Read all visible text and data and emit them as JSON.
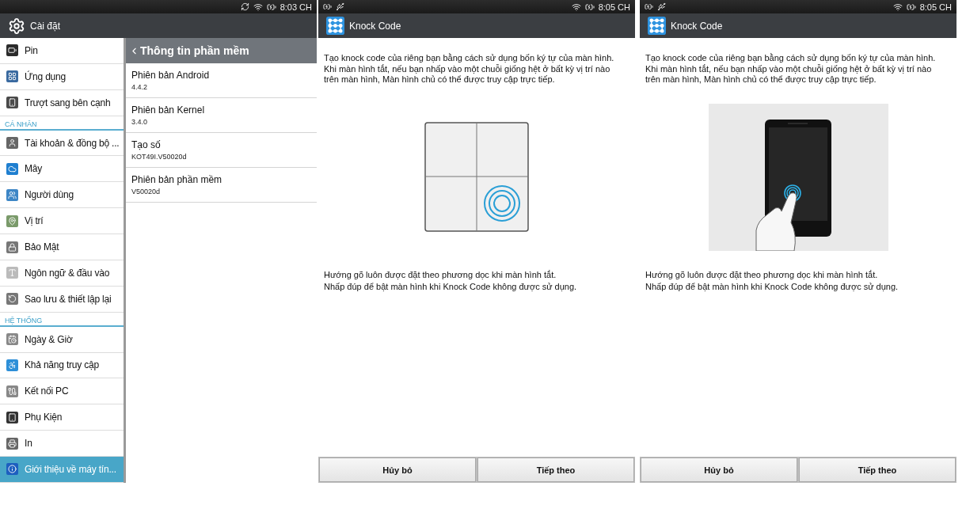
{
  "screens": [
    {
      "kind": "settings",
      "status_bar": {
        "time": "8:03 CH"
      },
      "title": "Cài đặt",
      "sidebar": [
        {
          "kind": "item",
          "label": "Pin",
          "selected": false
        },
        {
          "kind": "item",
          "label": "Ứng dụng",
          "selected": false
        },
        {
          "kind": "item",
          "label": "Trượt sang bên cạnh",
          "selected": false
        },
        {
          "kind": "header",
          "label": "CÁ NHÂN"
        },
        {
          "kind": "item",
          "label": "Tài khoản & đồng bộ ...",
          "selected": false
        },
        {
          "kind": "item",
          "label": "Mây",
          "selected": false
        },
        {
          "kind": "item",
          "label": "Người dùng",
          "selected": false
        },
        {
          "kind": "item",
          "label": "Vị trí",
          "selected": false
        },
        {
          "kind": "item",
          "label": "Bảo Mật",
          "selected": false
        },
        {
          "kind": "item",
          "label": "Ngôn ngữ & đầu vào",
          "selected": false
        },
        {
          "kind": "item",
          "label": "Sao lưu & thiết lập lại",
          "selected": false
        },
        {
          "kind": "header",
          "label": "HỆ THỐNG"
        },
        {
          "kind": "item",
          "label": "Ngày & Giờ",
          "selected": false
        },
        {
          "kind": "item",
          "label": "Khả năng truy cập",
          "selected": false
        },
        {
          "kind": "item",
          "label": "Kết nối PC",
          "selected": false
        },
        {
          "kind": "item",
          "label": "Phụ Kiện",
          "selected": false
        },
        {
          "kind": "item",
          "label": "In",
          "selected": false
        },
        {
          "kind": "item",
          "label": "Giới thiệu về máy tín...",
          "selected": true
        }
      ],
      "detail": {
        "title": "Thông tin phần mềm",
        "items": [
          {
            "label": "Phiên bản Android",
            "value": "4.4.2"
          },
          {
            "label": "Phiên bản Kernel",
            "value": "3.4.0"
          },
          {
            "label": "Tạo số",
            "value": "KOT49I.V50020d"
          },
          {
            "label": "Phiên bản phần mềm",
            "value": "V50020d"
          }
        ]
      }
    },
    {
      "kind": "knock_code",
      "status_bar": {
        "time": "8:05 CH"
      },
      "title": "Knock Code",
      "intro": "Tạo knock code của riêng bạn bằng cách sử dụng bốn ký tự của màn hình. Khi màn hình tắt, nếu bạn nhấp vào một chuỗi giống hệt ở bất kỳ vị trí nào trên màn hình, Màn hình chủ có thể được truy cập trực tiếp.",
      "illustration": {
        "kind": "grid"
      },
      "notes": [
        "Hướng gõ luôn được đặt theo phương dọc khi màn hình tắt.",
        "Nhấp đúp để bật màn hình khi Knock Code không được sử dụng."
      ],
      "buttons": [
        "Hủy bỏ",
        "Tiếp theo"
      ]
    },
    {
      "kind": "knock_code",
      "status_bar": {
        "time": "8:05 CH"
      },
      "title": "Knock Code",
      "intro": "Tạo knock code của riêng bạn bằng cách sử dụng bốn ký tự của màn hình. Khi màn hình tắt, nếu bạn nhấp vào một chuỗi giống hệt ở bất kỳ vị trí nào trên màn hình, Màn hình chủ có thể được truy cập trực tiếp.",
      "illustration": {
        "kind": "phone"
      },
      "notes": [
        "Hướng gõ luôn được đặt theo phương dọc khi màn hình tắt.",
        "Nhấp đúp để bật màn hình khi Knock Code không được sử dụng."
      ],
      "buttons": [
        "Hủy bỏ",
        "Tiếp theo"
      ]
    }
  ]
}
